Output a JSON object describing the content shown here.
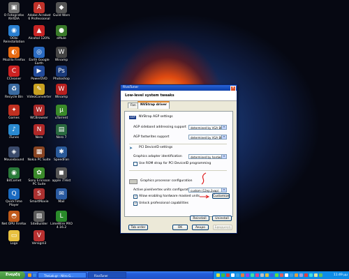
{
  "desktop_icons": [
    {
      "label": "O Fotografos NVIDIA",
      "symbol": "▣",
      "color": "#6d6d6d"
    },
    {
      "label": "Adobe Acrobat 6 Professional",
      "symbol": "A",
      "color": "#c0322a"
    },
    {
      "label": "Guild Wars",
      "symbol": "◆",
      "color": "#555"
    },
    {
      "label": "OObi Reinstallation",
      "symbol": "◉",
      "color": "#2a7fd0"
    },
    {
      "label": "Alcohol 120%",
      "symbol": "▲",
      "color": "#c82424"
    },
    {
      "label": "eMule",
      "symbol": "●",
      "color": "#3a7a2a"
    },
    {
      "label": "Mozilla Firefox",
      "symbol": "◐",
      "color": "#e86b12"
    },
    {
      "label": "Earth Google Earth",
      "symbol": "◎",
      "color": "#2a6ac0"
    },
    {
      "label": "Winamp",
      "symbol": "W",
      "color": "#444"
    },
    {
      "label": "CCleaner",
      "symbol": "C",
      "color": "#c22"
    },
    {
      "label": "PowerDVD",
      "symbol": "▶",
      "color": "#224a9a"
    },
    {
      "label": "Photoshop",
      "symbol": "Ps",
      "color": "#1a3a7a"
    },
    {
      "label": "Recycle Bin",
      "symbol": "♻",
      "color": "#3a6aa0"
    },
    {
      "label": "VideoConverter",
      "symbol": "✎",
      "color": "#c8a020"
    },
    {
      "label": "Winamp",
      "symbol": "W",
      "color": "#b82020"
    },
    {
      "label": "Games",
      "symbol": "✦",
      "color": "#c03020"
    },
    {
      "label": "WCBrowser",
      "symbol": "W",
      "color": "#a82828"
    },
    {
      "label": "uTorrent",
      "symbol": "µ",
      "color": "#3a8a2a"
    },
    {
      "label": "iTunes",
      "symbol": "♪",
      "color": "#2a8ad0"
    },
    {
      "label": "Nero",
      "symbol": "N",
      "color": "#b02828"
    },
    {
      "label": "Nero 7",
      "symbol": "▤",
      "color": "#2a6a40"
    },
    {
      "label": "Mousebound",
      "symbol": "◈",
      "color": "#3a4a6a"
    },
    {
      "label": "Nokia PC Suite",
      "symbol": "▦",
      "color": "#884422"
    },
    {
      "label": "SpeedFan",
      "symbol": "✱",
      "color": "#2a5a9a"
    },
    {
      "label": "BitComet",
      "symbol": "◉",
      "color": "#2a7a3a"
    },
    {
      "label": "Sony Ericsson PC Suite",
      "symbol": "✿",
      "color": "#3a8a2a"
    },
    {
      "label": "apple iTHist",
      "symbol": "◼",
      "color": "#555"
    },
    {
      "label": "QuickTime Player",
      "symbol": "Q",
      "color": "#1a6ac0"
    },
    {
      "label": "SmartMovie",
      "symbol": "S",
      "color": "#aa3030"
    },
    {
      "label": "Mail",
      "symbol": "✉",
      "color": "#2a5aa0"
    },
    {
      "label": "Net OPU Firefox",
      "symbol": "◓",
      "color": "#c05a1a"
    },
    {
      "label": "SiteBuilder",
      "symbol": "▨",
      "color": "#5a5a5a"
    },
    {
      "label": "LimeWire PRO 4.16.2",
      "symbol": "L",
      "color": "#2a8a2a"
    },
    {
      "label": "Logo",
      "symbol": "▭",
      "color": "#e8c040"
    },
    {
      "label": "Versignl3",
      "symbol": "V",
      "color": "#b83030"
    }
  ],
  "window": {
    "title": "RivaTuner",
    "header": "Low-level system tweaks",
    "tabs": [
      {
        "label": "Fan",
        "active": false
      },
      {
        "label": "NVStrap driver",
        "active": true
      }
    ],
    "sections": {
      "nvstrap_agp": "NVStrap AGP settings",
      "pci_deviceid": "PCI DeviceID settings",
      "graphics_processor": "Graphics processor configuration"
    },
    "fields": {
      "agp_sideband_label": "AGP sideband addressing support",
      "agp_sideband_value": "determined by VGA BIOS",
      "agp_fastwrites_label": "AGP fastwrites support",
      "agp_fastwrites_value": "determined by VGA BIOS",
      "adapter_id_label": "Graphics adapter identification",
      "adapter_id_value": "determined by hardware",
      "rom_strap_label": "Use ROM strap for PCI DeviceID programming",
      "rom_strap_checked": false,
      "active_units_label": "Active pixel/vertex units configuration",
      "active_units_value": "custom (12ep,3vap)",
      "allow_masked_label": "Allow enabling hardware masked units",
      "allow_masked_checked": true,
      "unlock_label": "Unlock professional capabilities",
      "unlock_checked": true
    },
    "buttons": {
      "customize": "Customize",
      "reinstall": "Reinstall",
      "uninstall": "Uninstall",
      "tab_order": "Tab order",
      "ok": "OK",
      "cancel": "Άκυρο",
      "apply": "Εφαρμογή"
    },
    "check_mark": "✓",
    "close_symbol": "×",
    "dropdown_arrow": "▾"
  },
  "taskbar": {
    "start_label": "Έναρξη",
    "tasks": [
      {
        "label": "TheLab.gr - Nitro G...",
        "active": false
      },
      {
        "label": "RivaTuner",
        "active": true
      }
    ],
    "clock": "11:49 μμ"
  }
}
